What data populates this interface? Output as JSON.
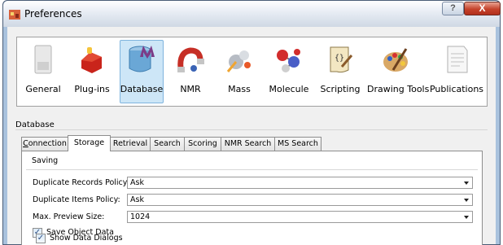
{
  "window": {
    "title": "Preferences",
    "help_label": "?",
    "close_label": "X"
  },
  "categories": [
    {
      "label": "General",
      "icon": "switch-icon"
    },
    {
      "label": "Plug-ins",
      "icon": "plugins-icon"
    },
    {
      "label": "Database",
      "icon": "database-icon",
      "selected": true
    },
    {
      "label": "NMR",
      "icon": "magnet-icon"
    },
    {
      "label": "Mass",
      "icon": "mass-icon"
    },
    {
      "label": "Molecule",
      "icon": "molecule-icon"
    },
    {
      "label": "Scripting",
      "icon": "scripting-icon"
    },
    {
      "label": "Drawing Tools",
      "icon": "palette-icon"
    },
    {
      "label": "Publications",
      "icon": "publications-icon"
    }
  ],
  "database": {
    "group_title": "Database",
    "tabs": [
      {
        "label": "Connection",
        "mnemonic": "C"
      },
      {
        "label": "Storage",
        "mnemonic": "t",
        "active": true
      },
      {
        "label": "Retrieval",
        "mnemonic": "R"
      },
      {
        "label": "Search",
        "mnemonic": "e"
      },
      {
        "label": "Scoring",
        "mnemonic": ""
      },
      {
        "label": "NMR Search",
        "mnemonic": "N"
      },
      {
        "label": "MS Search",
        "mnemonic": "M"
      }
    ],
    "storage": {
      "section_label": "Saving",
      "fields": [
        {
          "label": "Duplicate Records Policy:",
          "value": "Ask"
        },
        {
          "label": "Duplicate Items Policy:",
          "value": "Ask"
        },
        {
          "label": "Max. Preview Size:",
          "value": "1024"
        }
      ],
      "checkboxes": [
        {
          "label": "Save Object Data",
          "checked": true
        },
        {
          "label": "Show Data Dialogs",
          "checked": true
        }
      ]
    }
  },
  "colors": {
    "selection_bg": "#cde6f7",
    "frame": "#a9c2dd",
    "close_red": "#c5422b"
  }
}
